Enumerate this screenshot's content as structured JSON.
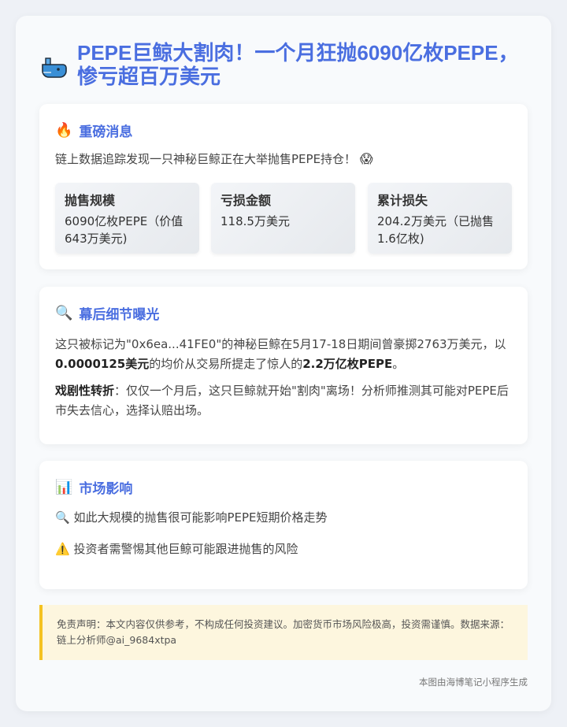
{
  "header": {
    "title": "PEPE巨鲸大割肉！一个月狂抛6090亿枚PEPE，惨亏超百万美元",
    "icon": "whale-icon"
  },
  "news": {
    "title": "重磅消息",
    "icon": "fire-icon",
    "intro": "链上数据追踪发现一只神秘巨鲸正在大举抛售PEPE持仓！",
    "intro_icon": "scream-face-icon",
    "stats": [
      {
        "label": "抛售规模",
        "value": "6090亿枚PEPE（价值643万美元)"
      },
      {
        "label": "亏损金额",
        "value": "118.5万美元"
      },
      {
        "label": "累计损失",
        "value": "204.2万美元（已抛售1.6亿枚)"
      }
    ]
  },
  "detail": {
    "title": "幕后细节曝光",
    "icon": "magnifier-icon",
    "p1_a": "这只被标记为\"0x6ea...41FE0\"的神秘巨鲸在5月17-18日期间曾豪掷2763万美元，以",
    "p1_b": "0.0000125美元",
    "p1_c": "的均价从交易所提走了惊人的",
    "p1_d": "2.2万亿枚PEPE",
    "p1_e": "。",
    "p2_label": "戏剧性转折",
    "p2_text": "：仅仅一个月后，这只巨鲸就开始\"割肉\"离场！分析师推测其可能对PEPE后市失去信心，选择认赔出场。"
  },
  "market": {
    "title": "市场影响",
    "icon": "bar-chart-icon",
    "items": [
      {
        "icon": "magnifier-icon",
        "text": "如此大规模的抛售很可能影响PEPE短期价格走势"
      },
      {
        "icon": "warning-icon",
        "text": "投资者需警惕其他巨鲸可能跟进抛售的风险"
      }
    ]
  },
  "disclaimer": "免责声明：本文内容仅供参考，不构成任何投资建议。加密货币市场风险极高，投资需谨慎。数据来源：链上分析师@ai_9684xtpa",
  "footer": "本图由海博笔记小程序生成",
  "colors": {
    "accent": "#4a6ee0",
    "warning_bar": "#f4c220",
    "disclaimer_bg": "#fdf6de"
  }
}
